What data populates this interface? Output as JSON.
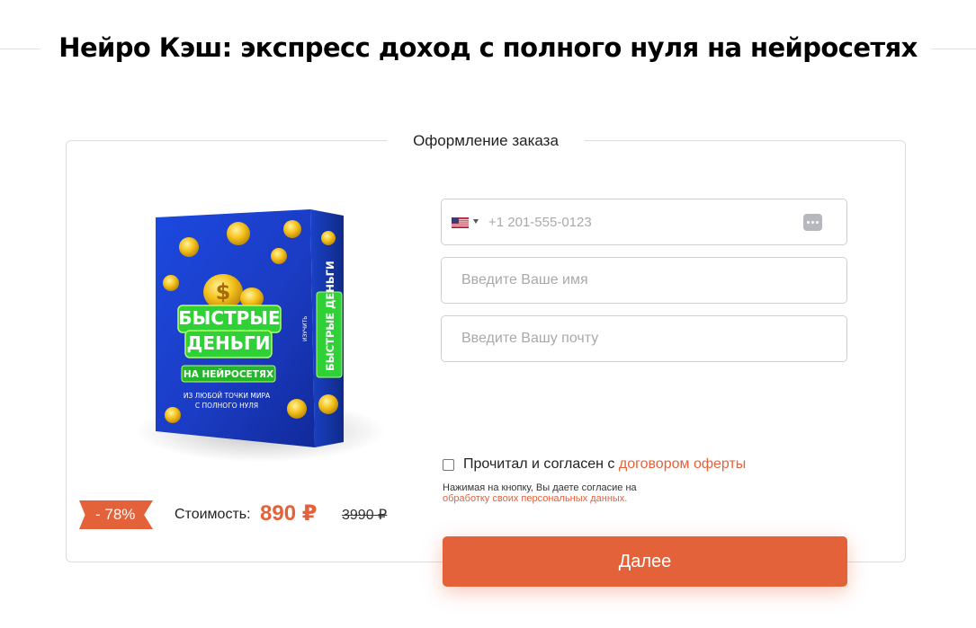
{
  "page": {
    "title": "Нейро Кэш: экспресс доход с полного нуля на нейросетях"
  },
  "order": {
    "legend": "Оформление заказа",
    "product_image": {
      "main_line1": "БЫСТРЫЕ",
      "main_line2": "ДЕНЬГИ",
      "badge": "НА НЕЙРОСЕТЯХ",
      "sub_line1": "ИЗ ЛЮБОЙ ТОЧКИ МИРА",
      "sub_line2": "С ПОЛНОГО НУЛЯ",
      "spine_main": "БЫСТРЫЕ ДЕНЬГИ",
      "spine_small": "ИЗУЧИТЬ"
    },
    "price": {
      "discount": "- 78%",
      "label": "Стоимость:",
      "new": "890 ₽",
      "old": "3990 ₽"
    }
  },
  "form": {
    "phone": {
      "country_flag": "us-flag-icon",
      "placeholder": "+1 201-555-0123"
    },
    "name": {
      "placeholder": "Введите Ваше имя"
    },
    "email": {
      "placeholder": "Введите Вашу почту"
    },
    "agreement": {
      "text": "Прочитал и согласен с ",
      "link": "договором оферты",
      "checked": false
    },
    "consent": {
      "text": "Нажимая на кнопку, Вы даете согласие на",
      "link": "обработку своих персональных данных."
    },
    "submit_label": "Далее"
  },
  "colors": {
    "accent": "#e4623a",
    "text": "#1a1a1a",
    "border": "#cfcfcf"
  }
}
